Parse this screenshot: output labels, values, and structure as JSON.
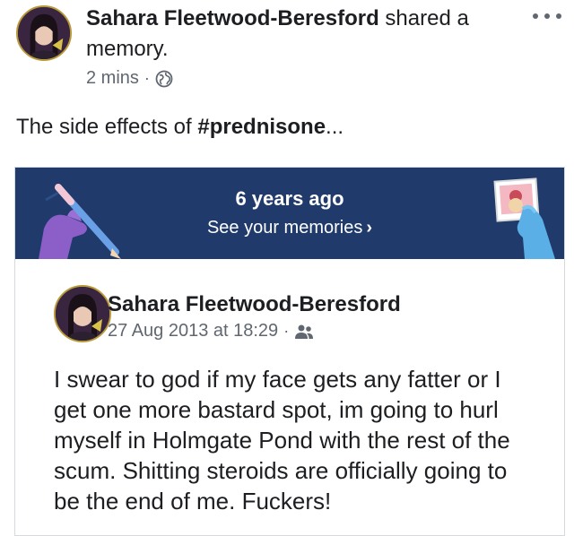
{
  "post": {
    "author": "Sahara Fleetwood-Beresford",
    "action": "shared a memory.",
    "time": "2 mins",
    "separator": "·",
    "audience_icon": "globe-icon",
    "more_icon": "more-options-icon",
    "caption_prefix": "The side effects of ",
    "caption_hashtag": "#prednisone",
    "caption_suffix": "..."
  },
  "memory": {
    "title": "6 years ago",
    "link_label": "See your memories",
    "link_chevron": "›",
    "banner_color": "#1f3a6b",
    "original_post": {
      "author": "Sahara Fleetwood-Beresford",
      "date": "27 Aug 2013 at 18:29",
      "separator": "·",
      "audience_icon": "friends-icon",
      "body": "I swear to god if my face gets any fatter or I get one more bastard spot, im going to hurl myself in Holmgate Pond with the rest of the scum. Shitting steroids are officially going to be the end of me. Fuckers!"
    }
  }
}
